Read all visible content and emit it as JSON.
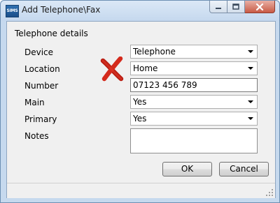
{
  "window": {
    "app_icon_text": "SIMS",
    "title": "Add Telephone\\Fax"
  },
  "group": {
    "title": "Telephone details"
  },
  "form": {
    "device": {
      "label": "Device",
      "value": "Telephone"
    },
    "location": {
      "label": "Location",
      "value": "Home"
    },
    "number": {
      "label": "Number",
      "value": "07123 456 789"
    },
    "main": {
      "label": "Main",
      "value": "Yes"
    },
    "primary": {
      "label": "Primary",
      "value": "Yes"
    },
    "notes": {
      "label": "Notes",
      "value": ""
    }
  },
  "buttons": {
    "ok": "OK",
    "cancel": "Cancel"
  },
  "annotation": {
    "icon": "red-x-icon",
    "color": "#d42a1c"
  },
  "colors": {
    "titlebar": "#c5d8ee",
    "client": "#f0f0f0",
    "close_button": "#c85a45"
  }
}
